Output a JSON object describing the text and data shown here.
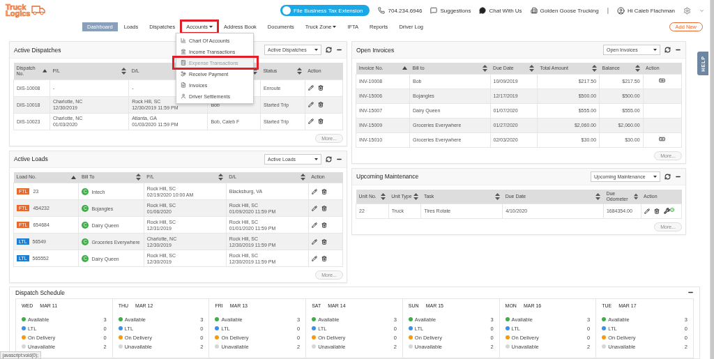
{
  "logo": {
    "line1": "Truck",
    "line2": "Logics"
  },
  "header": {
    "tax_button": "File Business Tax Extension",
    "phone": "704.234.6946",
    "suggestions": "Suggestions",
    "chat": "Chat With Us",
    "company": "Golden Goose Trucking",
    "separator": "|",
    "user": "Hi Caleb Flachman"
  },
  "nav": {
    "items": [
      {
        "label": "Dashboard",
        "selected": true,
        "caret": false,
        "annotated": false
      },
      {
        "label": "Loads",
        "selected": false,
        "caret": false,
        "annotated": false
      },
      {
        "label": "Dispatches",
        "selected": false,
        "caret": false,
        "annotated": false
      },
      {
        "label": "Accounts",
        "selected": false,
        "caret": true,
        "annotated": true
      },
      {
        "label": "Address Book",
        "selected": false,
        "caret": false,
        "annotated": false
      },
      {
        "label": "Documents",
        "selected": false,
        "caret": false,
        "annotated": false
      },
      {
        "label": "Truck Zone",
        "selected": false,
        "caret": true,
        "annotated": false
      },
      {
        "label": "IFTA",
        "selected": false,
        "caret": false,
        "annotated": false
      },
      {
        "label": "Reports",
        "selected": false,
        "caret": false,
        "annotated": false
      },
      {
        "label": "Driver Log",
        "selected": false,
        "caret": false,
        "annotated": false
      }
    ],
    "add_button": "Add New"
  },
  "accounts_menu": {
    "items": [
      {
        "label": "Chart Of Accounts",
        "hovered": false,
        "annotated": false
      },
      {
        "label": "Income Transactions",
        "hovered": false,
        "annotated": false
      },
      {
        "label": "Expense Transactions",
        "hovered": true,
        "annotated": true
      },
      {
        "label": "Receive Payment",
        "hovered": false,
        "annotated": false
      },
      {
        "label": "Invoices",
        "hovered": false,
        "annotated": false
      },
      {
        "label": "Driver Settlements",
        "hovered": false,
        "annotated": false
      }
    ]
  },
  "active_dispatches": {
    "title": "Active Dispatches",
    "filter": "Active Dispatches",
    "more": "More...",
    "columns": [
      {
        "label": "Dispatch No.",
        "sortable": true,
        "sorted": true
      },
      {
        "label": "P/L",
        "sortable": true,
        "sorted": false
      },
      {
        "label": "D/L",
        "sortable": true,
        "sorted": false
      },
      {
        "sortable": true,
        "sorted": false
      },
      {
        "label": "Status",
        "sortable": true,
        "sorted": false
      },
      {
        "label": "Action",
        "sortable": false
      }
    ],
    "rows": [
      {
        "cells": [
          "DIS-10008",
          "-",
          "-",
          null,
          "Enroute"
        ]
      },
      {
        "cells": [
          "DIS-10018",
          "Charlotte, NC\n12/30/2019",
          "Rock Hill, SC\n12/30/2019 11:59 PM",
          "Bob",
          "Started Trip"
        ]
      },
      {
        "cells": [
          "DIS-10023",
          "Charlotte, NC\n01/03/2020",
          "Atlanta, GA\n01/03/2020 11:59 PM",
          "Bob, Caleb F",
          "Started Trip"
        ]
      }
    ]
  },
  "active_loads": {
    "title": "Active Loads",
    "filter": "Active Loads",
    "more": "More...",
    "columns": [
      {
        "label": "Load No.",
        "sortable": true,
        "sorted": true
      },
      {
        "label": "Bill To",
        "sortable": true,
        "sorted": false
      },
      {
        "label": "P/L",
        "sortable": true,
        "sorted": false
      },
      {
        "label": "D/L",
        "sortable": true,
        "sorted": false
      },
      {
        "label": "Action",
        "sortable": false
      }
    ],
    "rows": [
      {
        "tag": "FTL",
        "color": "#e8692c",
        "load_no": "23",
        "badge": "C",
        "bill_to": "Intech",
        "pl": "Rock Hill, SC\n02/19/2020 10:00 AM",
        "dl": "Blacksburg, VA"
      },
      {
        "tag": "FTL",
        "color": "#e8692c",
        "load_no": "454232",
        "badge": "C",
        "bill_to": "Bojangles",
        "pl": "Rock Hill, SC\n01/06/2020",
        "dl": "Rock Hill, SC\n01/09/2020 11:59 PM"
      },
      {
        "tag": "FTL",
        "color": "#e8692c",
        "load_no": "654684",
        "badge": "C",
        "bill_to": "Dairy Queen",
        "pl": "Rock Hill, SC\n12/31/2019",
        "dl": "Rock Hill, SC\n01/01/2020 11:59 PM"
      },
      {
        "tag": "LTL",
        "color": "#1a7fd4",
        "load_no": "56549",
        "badge": "C",
        "bill_to": "Groceries Everywhere",
        "pl": "Charlotte, NC\n12/30/2019",
        "dl": "Rock Hill, SC\n12/30/2019 11:59 PM"
      },
      {
        "tag": "LTL",
        "color": "#1a7fd4",
        "load_no": "565552",
        "badge": "C",
        "bill_to": "Dairy Queen",
        "pl": "Rock Hill, SC\n12/30/2019",
        "dl": "Rock Hill, SC\n12/30/2019 11:59 PM"
      }
    ]
  },
  "open_invoices": {
    "title": "Open Invoices",
    "filter": "Open Invoices",
    "more": "More...",
    "columns": [
      {
        "label": "Invoice No.",
        "sortable": true,
        "sorted": true
      },
      {
        "label": "Bill to",
        "sortable": true,
        "sorted": false
      },
      {
        "label": "Due Date",
        "sortable": true,
        "sorted": false
      },
      {
        "label": "Total Amount",
        "sortable": true,
        "sorted": false
      },
      {
        "label": "Balance",
        "sortable": true,
        "sorted": false
      },
      {
        "label": "Action",
        "sortable": false
      }
    ],
    "rows": [
      {
        "invoice": "INV-10008",
        "bill_to": "Bob",
        "due": "10/09/2019",
        "total": "$217.50",
        "balance": "$217.50",
        "payment_action": true
      },
      {
        "invoice": "INV-15006",
        "bill_to": "Bojangles",
        "due": "12/17/2019",
        "total": "$500.00",
        "balance": "$500.00",
        "payment_action": false
      },
      {
        "invoice": "INV-15007",
        "bill_to": "Dairy Queen",
        "due": "01/07/2020",
        "total": "$555.00",
        "balance": "$555.00",
        "payment_action": false
      },
      {
        "invoice": "INV-15009",
        "bill_to": "Groceries Everywhere",
        "due": "01/27/2020",
        "total": "$2,060.00",
        "balance": "$2,060.00",
        "payment_action": false
      },
      {
        "invoice": "INV-15010",
        "bill_to": "Groceries Everywhere",
        "due": "02/03/2020",
        "total": "$30.00",
        "balance": "$30.00",
        "payment_action": true
      }
    ]
  },
  "upcoming_maintenance": {
    "title": "Upcoming Maintenance",
    "filter": "Upcoming Maintenance",
    "more": "More...",
    "columns": [
      {
        "label": "Unit No.",
        "sortable": true,
        "sorted": false
      },
      {
        "label": "Unit Type",
        "sortable": true,
        "sorted": false
      },
      {
        "label": "Task",
        "sortable": true,
        "sorted": false
      },
      {
        "label": "Due Date",
        "sortable": true,
        "sorted": false
      },
      {
        "label": "Due Odometer",
        "sortable": true,
        "sorted": false
      },
      {
        "label": "Action",
        "sortable": false
      }
    ],
    "rows": [
      {
        "cells": [
          "22",
          "Truck",
          "Tires Rotate",
          "4/10/2020",
          "1684354.00"
        ]
      }
    ]
  },
  "dispatch_schedule": {
    "title": "Dispatch Schedule",
    "days": [
      {
        "day": "WED",
        "date": "MAR 11",
        "stats": [
          {
            "label": "Available",
            "count": "3",
            "color": "#3fae49"
          },
          {
            "label": "LTL",
            "count": "0",
            "color": "#3d8fe0"
          },
          {
            "label": "On Delivery",
            "count": "0",
            "color": "#f39c12"
          },
          {
            "label": "Unavailable",
            "count": "2",
            "color": "#d6d6d6"
          }
        ]
      },
      {
        "day": "THU",
        "date": "MAR 12",
        "stats": [
          {
            "label": "Available",
            "count": "3",
            "color": "#3fae49"
          },
          {
            "label": "LTL",
            "count": "0",
            "color": "#3d8fe0"
          },
          {
            "label": "On Delivery",
            "count": "0",
            "color": "#f39c12"
          },
          {
            "label": "Unavailable",
            "count": "2",
            "color": "#d6d6d6"
          }
        ]
      },
      {
        "day": "FRI",
        "date": "MAR 13",
        "stats": [
          {
            "label": "Available",
            "count": "3",
            "color": "#3fae49"
          },
          {
            "label": "LTL",
            "count": "0",
            "color": "#3d8fe0"
          },
          {
            "label": "On Delivery",
            "count": "0",
            "color": "#f39c12"
          },
          {
            "label": "Unavailable",
            "count": "2",
            "color": "#d6d6d6"
          }
        ]
      },
      {
        "day": "SAT",
        "date": "MAR 14",
        "stats": [
          {
            "label": "Available",
            "count": "3",
            "color": "#3fae49"
          },
          {
            "label": "LTL",
            "count": "0",
            "color": "#3d8fe0"
          },
          {
            "label": "On Delivery",
            "count": "0",
            "color": "#f39c12"
          },
          {
            "label": "Unavailable",
            "count": "2",
            "color": "#d6d6d6"
          }
        ]
      },
      {
        "day": "SUN",
        "date": "MAR 15",
        "stats": [
          {
            "label": "Available",
            "count": "3",
            "color": "#3fae49"
          },
          {
            "label": "LTL",
            "count": "0",
            "color": "#3d8fe0"
          },
          {
            "label": "On Delivery",
            "count": "0",
            "color": "#f39c12"
          },
          {
            "label": "Unavailable",
            "count": "2",
            "color": "#d6d6d6"
          }
        ]
      },
      {
        "day": "MON",
        "date": "MAR 16",
        "stats": [
          {
            "label": "Available",
            "count": "3",
            "color": "#3fae49"
          },
          {
            "label": "LTL",
            "count": "0",
            "color": "#3d8fe0"
          },
          {
            "label": "On Delivery",
            "count": "0",
            "color": "#f39c12"
          },
          {
            "label": "Unavailable",
            "count": "2",
            "color": "#d6d6d6"
          }
        ]
      },
      {
        "day": "TUE",
        "date": "MAR 17",
        "stats": [
          {
            "label": "Available",
            "count": "3",
            "color": "#3fae49"
          },
          {
            "label": "LTL",
            "count": "0",
            "color": "#3d8fe0"
          },
          {
            "label": "On Delivery",
            "count": "0",
            "color": "#f39c12"
          },
          {
            "label": "Unavailable",
            "count": "2",
            "color": "#d6d6d6"
          }
        ]
      }
    ]
  },
  "help_tab": "HELP",
  "status_bar": "javascript:void(0);"
}
